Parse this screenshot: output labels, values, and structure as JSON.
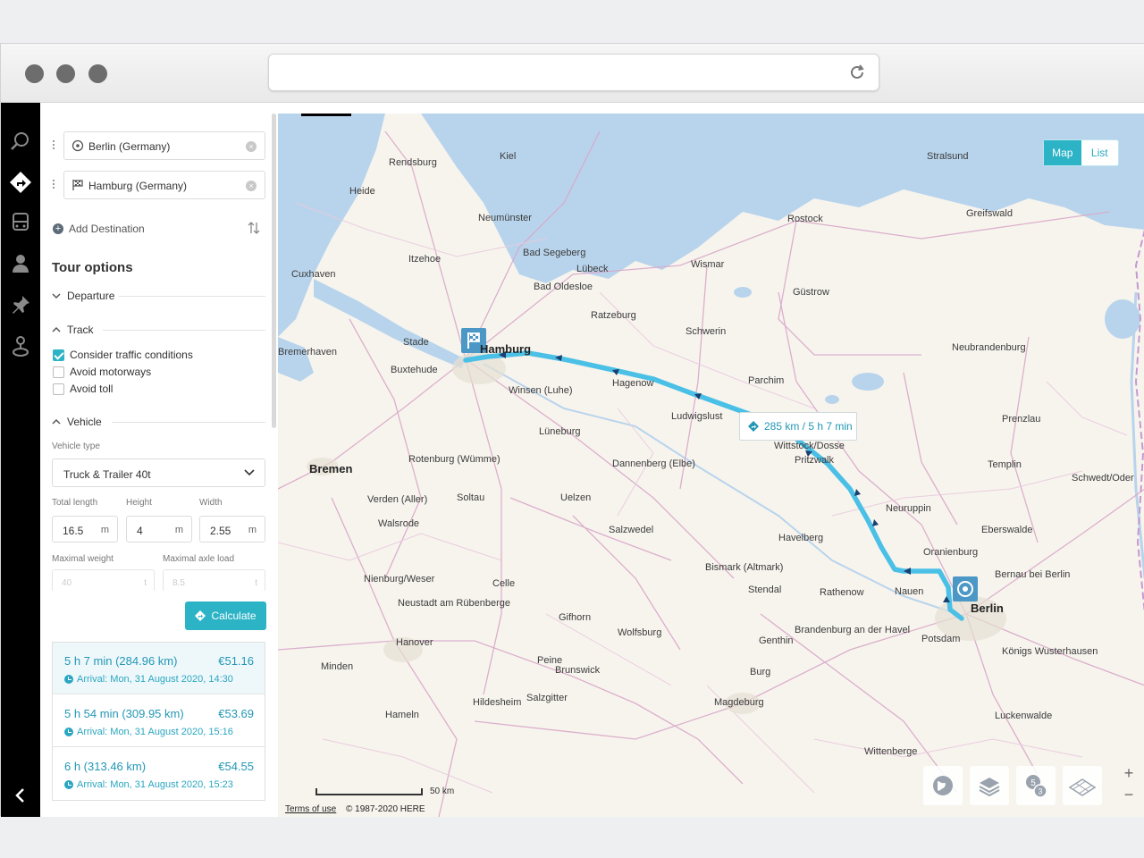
{
  "sidebar": {
    "route": {
      "origin": "Berlin (Germany)",
      "destination": "Hamburg (Germany)",
      "add_destination": "Add Destination"
    },
    "tour_options": {
      "title": "Tour options",
      "departure": "Departure",
      "track": "Track",
      "checkboxes": [
        {
          "label": "Consider traffic conditions",
          "checked": true
        },
        {
          "label": "Avoid motorways",
          "checked": false
        },
        {
          "label": "Avoid toll",
          "checked": false
        }
      ],
      "vehicle": "Vehicle",
      "vehicle_type_label": "Vehicle type",
      "vehicle_type": "Truck & Trailer 40t",
      "total_length_label": "Total length",
      "total_length": "16.5",
      "height_label": "Height",
      "height": "4",
      "width_label": "Width",
      "width": "2.55",
      "unit_m": "m",
      "max_weight_label": "Maximal weight",
      "max_weight": "40",
      "unit_t": "t",
      "max_axle_label": "Maximal axle load",
      "max_axle": "8.5",
      "calculate": "Calculate"
    },
    "results": [
      {
        "summary": "5 h 7 min (284.96 km)",
        "price": "€51.16",
        "arrival": "Arrival: Mon, 31 August 2020, 14:30"
      },
      {
        "summary": "5 h 54 min (309.95 km)",
        "price": "€53.69",
        "arrival": "Arrival: Mon, 31 August 2020, 15:16"
      },
      {
        "summary": "6 h (313.46 km)",
        "price": "€54.55",
        "arrival": "Arrival: Mon, 31 August 2020, 15:23"
      }
    ]
  },
  "map": {
    "view_toggle": {
      "map": "Map",
      "list": "List"
    },
    "route_badge": "285 km / 5 h 7 min",
    "scale": "50 km",
    "terms": "Terms of use",
    "copyright": "© 1987-2020 HERE",
    "cities": [
      {
        "name": "Berlin",
        "big": true
      },
      {
        "name": "Hamburg",
        "big": true
      },
      {
        "name": "Bremen",
        "big": false
      },
      {
        "name": "Rostock",
        "big": false
      },
      {
        "name": "Schwerin",
        "big": false
      },
      {
        "name": "Lübeck",
        "big": false
      },
      {
        "name": "Kiel",
        "big": false
      },
      {
        "name": "Wismar",
        "big": false
      },
      {
        "name": "Neuruppin",
        "big": false
      },
      {
        "name": "Potsdam",
        "big": false
      },
      {
        "name": "Magdeburg",
        "big": false
      },
      {
        "name": "Hanover",
        "big": false
      },
      {
        "name": "Celle",
        "big": false
      },
      {
        "name": "Uelzen",
        "big": false
      },
      {
        "name": "Stendal",
        "big": false
      },
      {
        "name": "Wolfsburg",
        "big": false
      },
      {
        "name": "Brunswick",
        "big": false
      },
      {
        "name": "Salzgitter",
        "big": false
      },
      {
        "name": "Lüneburg",
        "big": false
      },
      {
        "name": "Neubrandenburg",
        "big": false
      },
      {
        "name": "Greifswald",
        "big": false
      },
      {
        "name": "Stralsund",
        "big": false
      },
      {
        "name": "Güstrow",
        "big": false
      },
      {
        "name": "Oranienburg",
        "big": false
      },
      {
        "name": "Eberswalde",
        "big": false
      },
      {
        "name": "Bremerhaven",
        "big": false
      },
      {
        "name": "Cuxhaven",
        "big": false
      },
      {
        "name": "Neumünster",
        "big": false
      },
      {
        "name": "Hildesheim",
        "big": false
      },
      {
        "name": "Brandenburg an der Havel",
        "big": false
      },
      {
        "name": "Wittenberge",
        "big": false
      },
      {
        "name": "Parchim",
        "big": false
      },
      {
        "name": "Ludwigslust",
        "big": false
      },
      {
        "name": "Templin",
        "big": false
      },
      {
        "name": "Prenzlau",
        "big": false
      },
      {
        "name": "Nauen",
        "big": false
      },
      {
        "name": "Soltau",
        "big": false
      },
      {
        "name": "Walsrode",
        "big": false
      },
      {
        "name": "Nienburg/Weser",
        "big": false
      },
      {
        "name": "Gifhorn",
        "big": false
      },
      {
        "name": "Wittstock/Dosse",
        "big": false
      },
      {
        "name": "Pritzwalk",
        "big": false
      },
      {
        "name": "Heide",
        "big": false
      },
      {
        "name": "Rendsburg",
        "big": false
      },
      {
        "name": "Itzehoe",
        "big": false
      },
      {
        "name": "Stade",
        "big": false
      },
      {
        "name": "Buxtehude",
        "big": false
      },
      {
        "name": "Winsen (Luhe)",
        "big": false
      },
      {
        "name": "Bad Segeberg",
        "big": false
      },
      {
        "name": "Bad Oldesloe",
        "big": false
      },
      {
        "name": "Ratzeburg",
        "big": false
      },
      {
        "name": "Hagenow",
        "big": false
      },
      {
        "name": "Dannenberg (Elbe)",
        "big": false
      },
      {
        "name": "Rathenow",
        "big": false
      },
      {
        "name": "Havelberg",
        "big": false
      },
      {
        "name": "Bismark (Altmark)",
        "big": false
      },
      {
        "name": "Salzwedel",
        "big": false
      },
      {
        "name": "Burg",
        "big": false
      },
      {
        "name": "Genthin",
        "big": false
      },
      {
        "name": "Rotenburg (Wümme)",
        "big": false
      },
      {
        "name": "Verden (Aller)",
        "big": false
      },
      {
        "name": "Neustadt am Rübenberge",
        "big": false
      },
      {
        "name": "Peine",
        "big": false
      },
      {
        "name": "Minden",
        "big": false
      },
      {
        "name": "Hameln",
        "big": false
      },
      {
        "name": "Luckenwalde",
        "big": false
      },
      {
        "name": "Königs Wusterhausen",
        "big": false
      },
      {
        "name": "Bernau bei Berlin",
        "big": false
      },
      {
        "name": "Schwedt/Oder",
        "big": false
      }
    ]
  },
  "colors": {
    "accent": "#2cb3c6",
    "route": "#4bc0e6",
    "marker": "#4b97c6"
  }
}
